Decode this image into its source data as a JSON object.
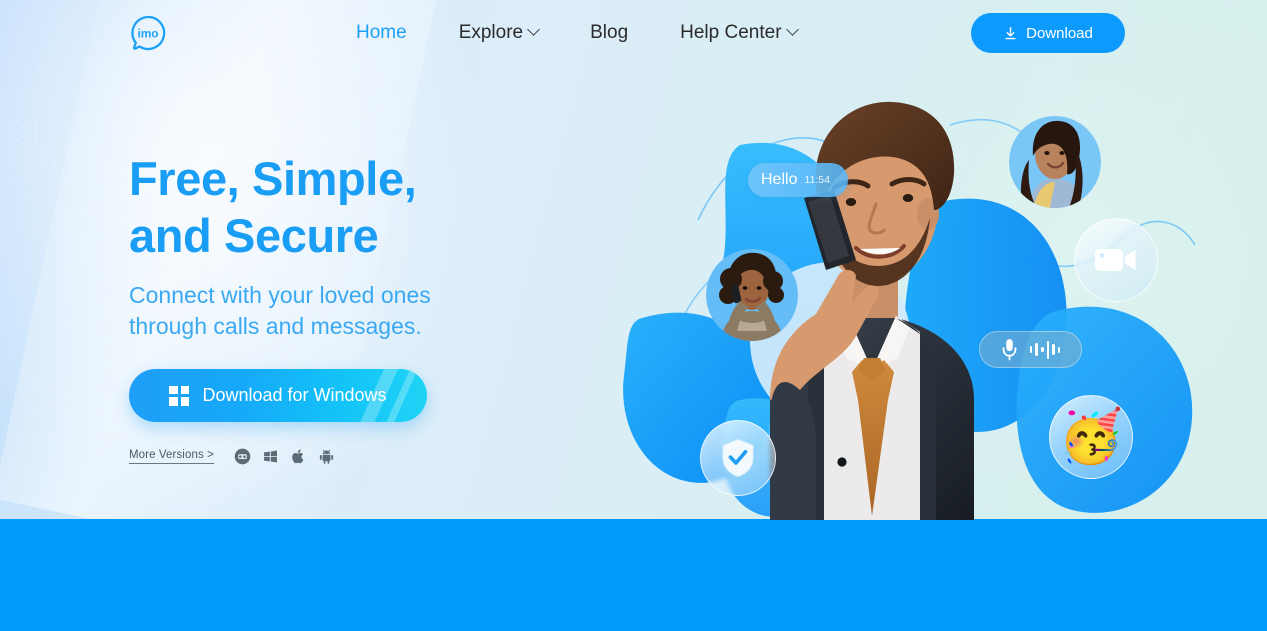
{
  "site": {
    "brand_name": "imo",
    "logo_icon": "imo-speech-bubble-logo"
  },
  "theme": {
    "accent_blue": "#1a9ef5",
    "nav_button_blue": "#0d9afd",
    "cta_gradient_start": "#1f9ef8",
    "cta_gradient_end": "#1fd4f5",
    "bottom_band_blue": "#009cfb",
    "heading_blue": "#1a9ef5",
    "subtitle_blue": "#3aa9f2",
    "hero_bg_left": "#bfdcfb",
    "hero_bg_right": "#d8f0ec"
  },
  "nav": {
    "items": [
      {
        "label": "Home",
        "active": true,
        "has_caret": false
      },
      {
        "label": "Explore",
        "active": false,
        "has_caret": true
      },
      {
        "label": "Blog",
        "active": false,
        "has_caret": false
      },
      {
        "label": "Help Center",
        "active": false,
        "has_caret": true
      }
    ],
    "download_button": {
      "label": "Download",
      "icon": "download-arrow-icon"
    }
  },
  "hero": {
    "title": "Free, Simple,\nand Secure",
    "subtitle": "Connect with your loved ones\nthrough calls and messages.",
    "cta": {
      "label": "Download for Windows",
      "icon": "windows-logo-icon"
    },
    "more_versions": {
      "label": "More Versions >"
    },
    "platform_icons": [
      {
        "name": "pc-circle-icon"
      },
      {
        "name": "windows-icon"
      },
      {
        "name": "apple-icon"
      },
      {
        "name": "android-icon"
      }
    ]
  },
  "illustration": {
    "chat_bubble": {
      "text": "Hello",
      "time": "11:54"
    },
    "badges": [
      {
        "name": "video-camera-icon"
      },
      {
        "name": "microphone-waveform-icon"
      },
      {
        "name": "shield-check-icon"
      },
      {
        "name": "party-face-emoji",
        "glyph": "🥳"
      }
    ],
    "avatars": [
      {
        "name": "avatar-woman-smiling"
      },
      {
        "name": "avatar-woman-on-phone"
      }
    ],
    "subject": "man-in-suit-on-phone"
  }
}
